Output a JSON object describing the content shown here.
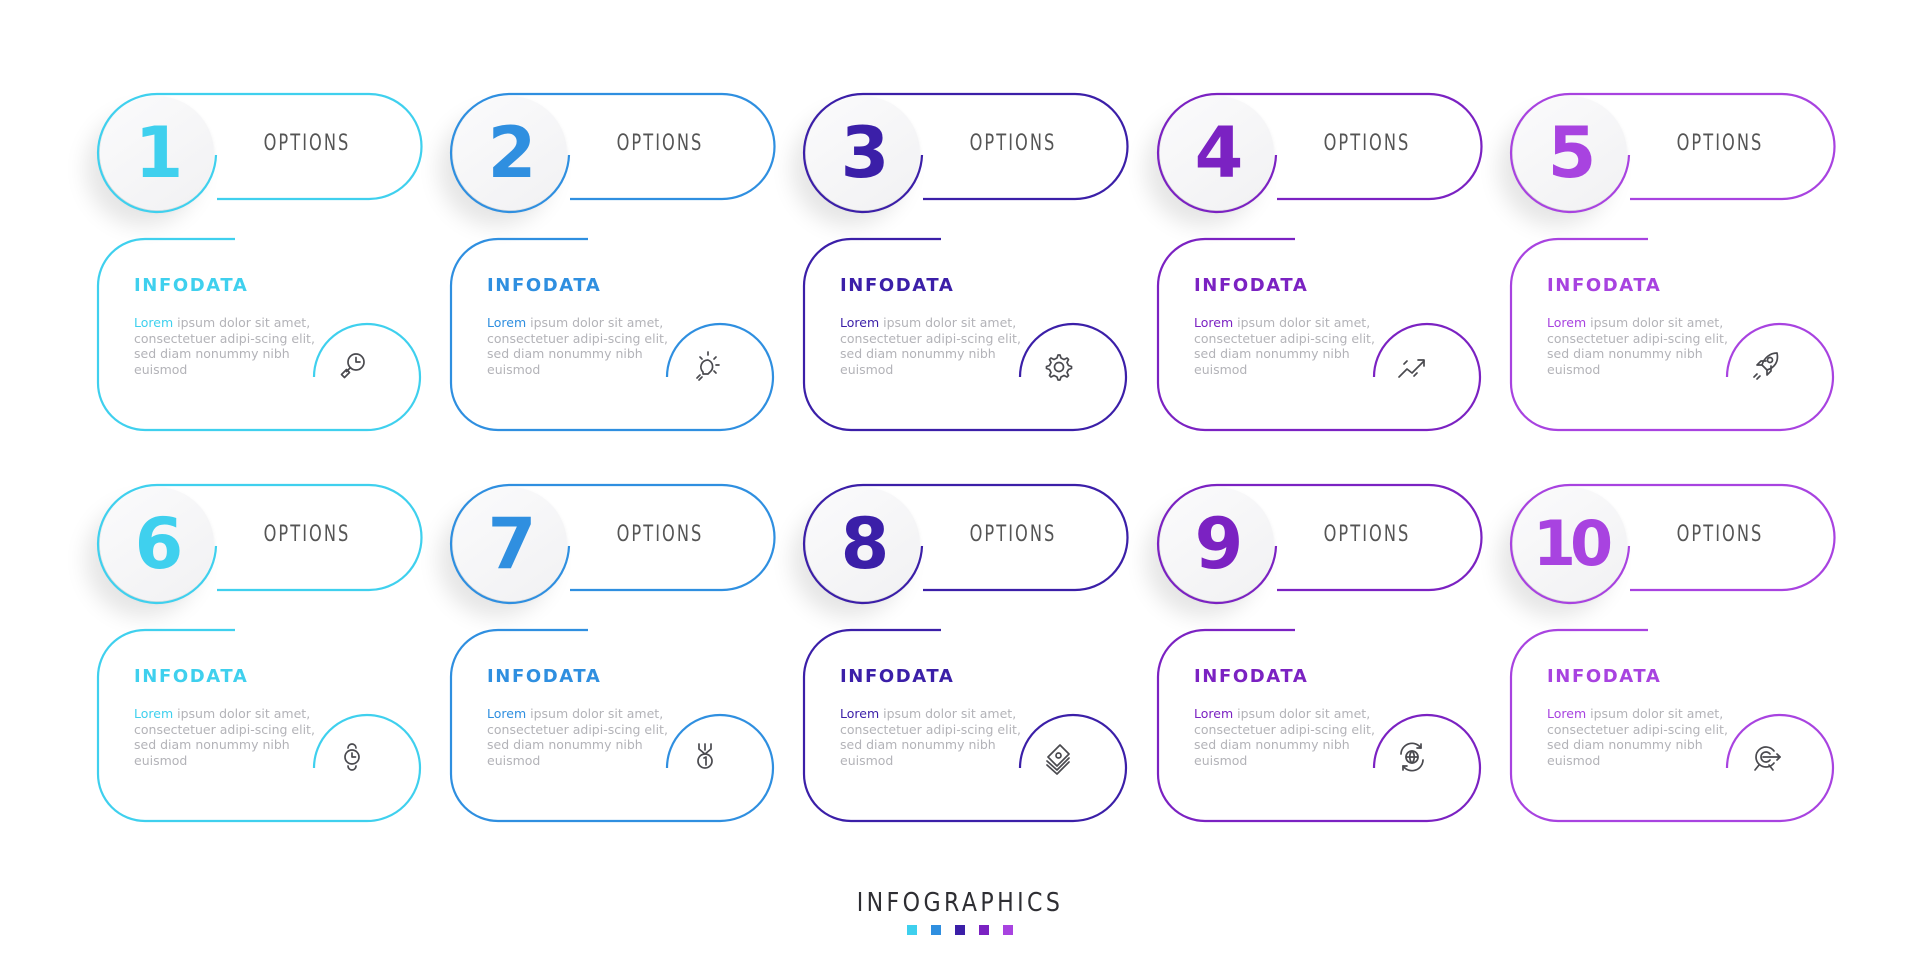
{
  "footer": {
    "title": "INFOGRAPHICS",
    "swatches": [
      "#3fd0ee",
      "#2f8fe0",
      "#3b1fa8",
      "#7b22c2",
      "#a843e0"
    ]
  },
  "steps": [
    {
      "number": "1",
      "label": "OPTIONS",
      "title": "INFODATA",
      "lead": "Lorem",
      "text": " ipsum dolor sit amet, consectetuer adipi-scing elit, sed diam nonummy nibh euismod",
      "color": "#3fd0ee",
      "icon": "search-clock-icon"
    },
    {
      "number": "2",
      "label": "OPTIONS",
      "title": "INFODATA",
      "lead": "Lorem",
      "text": " ipsum dolor sit amet, consectetuer adipi-scing elit, sed diam nonummy nibh euismod",
      "color": "#2f8fe0",
      "icon": "lightbulb-icon"
    },
    {
      "number": "3",
      "label": "OPTIONS",
      "title": "INFODATA",
      "lead": "Lorem",
      "text": " ipsum dolor sit amet, consectetuer adipi-scing elit, sed diam nonummy nibh euismod",
      "color": "#3b1fa8",
      "icon": "gear-icon"
    },
    {
      "number": "4",
      "label": "OPTIONS",
      "title": "INFODATA",
      "lead": "Lorem",
      "text": " ipsum dolor sit amet, consectetuer adipi-scing elit, sed diam nonummy nibh euismod",
      "color": "#7b22c2",
      "icon": "trend-up-icon"
    },
    {
      "number": "5",
      "label": "OPTIONS",
      "title": "INFODATA",
      "lead": "Lorem",
      "text": " ipsum dolor sit amet, consectetuer adipi-scing elit, sed diam nonummy nibh euismod",
      "color": "#a843e0",
      "icon": "rocket-icon"
    },
    {
      "number": "6",
      "label": "OPTIONS",
      "title": "INFODATA",
      "lead": "Lorem",
      "text": " ipsum dolor sit amet, consectetuer adipi-scing elit, sed diam nonummy nibh euismod",
      "color": "#3fd0ee",
      "icon": "wristwatch-icon"
    },
    {
      "number": "7",
      "label": "OPTIONS",
      "title": "INFODATA",
      "lead": "Lorem",
      "text": " ipsum dolor sit amet, consectetuer adipi-scing elit, sed diam nonummy nibh euismod",
      "color": "#2f8fe0",
      "icon": "medal-icon"
    },
    {
      "number": "8",
      "label": "OPTIONS",
      "title": "INFODATA",
      "lead": "Lorem",
      "text": " ipsum dolor sit amet, consectetuer adipi-scing elit, sed diam nonummy nibh euismod",
      "color": "#3b1fa8",
      "icon": "money-stack-icon"
    },
    {
      "number": "9",
      "label": "OPTIONS",
      "title": "INFODATA",
      "lead": "Lorem",
      "text": " ipsum dolor sit amet, consectetuer adipi-scing elit, sed diam nonummy nibh euismod",
      "color": "#7b22c2",
      "icon": "globe-refresh-icon"
    },
    {
      "number": "10",
      "label": "OPTIONS",
      "title": "INFODATA",
      "lead": "Lorem",
      "text": " ipsum dolor sit amet, consectetuer adipi-scing elit, sed diam nonummy nibh euismod",
      "color": "#a843e0",
      "icon": "target-arrow-icon"
    }
  ]
}
